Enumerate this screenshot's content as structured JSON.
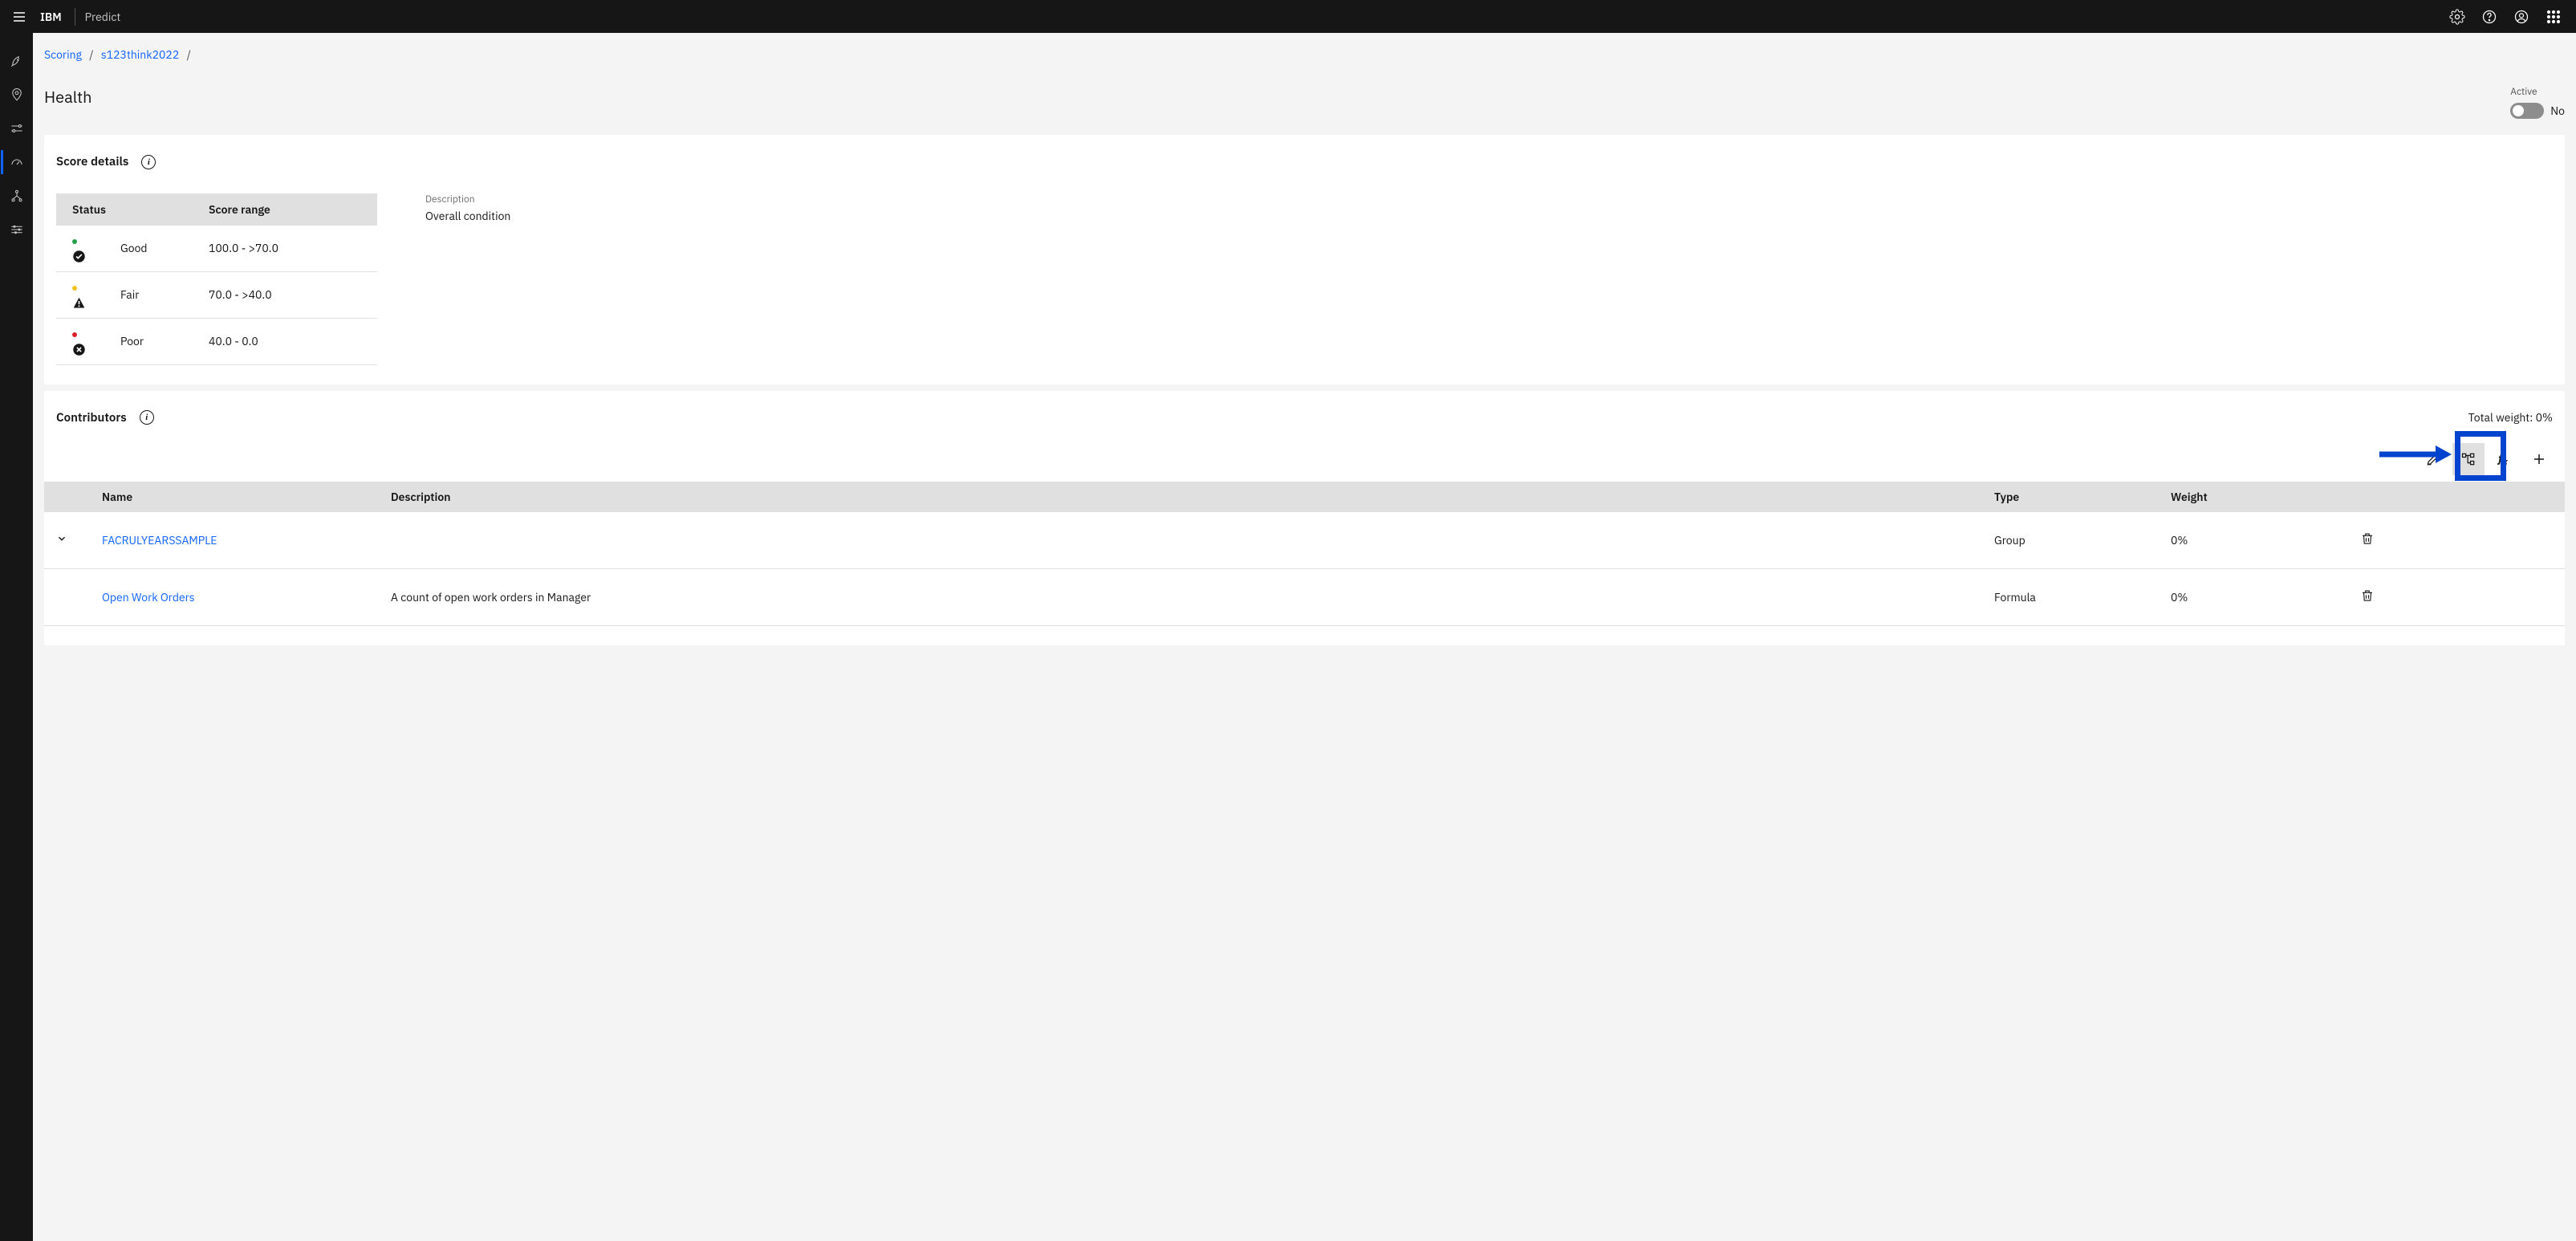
{
  "topbar": {
    "brand": "IBM",
    "app_name": "Predict"
  },
  "breadcrumb": {
    "items": [
      "Scoring",
      "s123think2022"
    ],
    "sep": "/"
  },
  "page": {
    "title": "Health",
    "active_label": "Active",
    "active_value": "No"
  },
  "score_details": {
    "title": "Score details",
    "headers": {
      "status": "Status",
      "range": "Score range"
    },
    "rows": [
      {
        "dot": "#24a148",
        "label": "Good",
        "range": "100.0 - >70.0",
        "icon": "check"
      },
      {
        "dot": "#f1c21b",
        "label": "Fair",
        "range": "70.0 - >40.0",
        "icon": "warn"
      },
      {
        "dot": "#da1e28",
        "label": "Poor",
        "range": "40.0 - 0.0",
        "icon": "x"
      }
    ],
    "description_label": "Description",
    "description_value": "Overall condition"
  },
  "contributors": {
    "title": "Contributors",
    "total_weight": "Total weight: 0%",
    "headers": {
      "name": "Name",
      "description": "Description",
      "type": "Type",
      "weight": "Weight"
    },
    "rows": [
      {
        "expandable": true,
        "name": "FACRULYEARSSAMPLE",
        "description": "",
        "type": "Group",
        "weight": "0%"
      },
      {
        "expandable": false,
        "name": "Open Work Orders",
        "description": "A count of open work orders in Manager",
        "type": "Formula",
        "weight": "0%"
      }
    ]
  }
}
